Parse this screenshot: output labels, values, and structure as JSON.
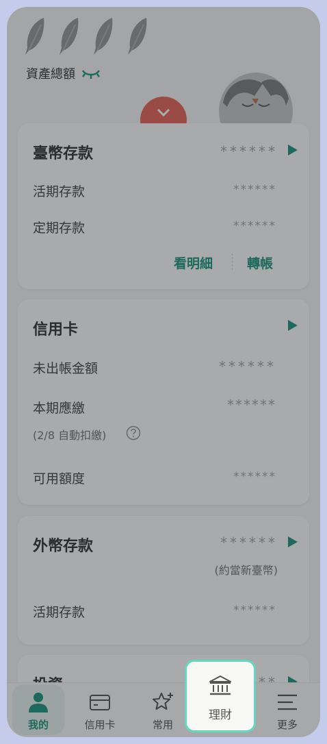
{
  "header": {
    "asset_title": "資產總額"
  },
  "cards": {
    "twd": {
      "title": "臺幣存款",
      "amount": "******",
      "rows": [
        {
          "label": "活期存款",
          "value": "******"
        },
        {
          "label": "定期存款",
          "value": "******"
        }
      ],
      "actions": {
        "details": "看明細",
        "transfer": "轉帳"
      }
    },
    "credit": {
      "title": "信用卡",
      "rows": [
        {
          "label": "未出帳金額",
          "value": "******"
        },
        {
          "label": "本期應繳",
          "value": "******",
          "note": "(2/8 自動扣繳)"
        },
        {
          "label": "可用額度",
          "value": "******"
        }
      ]
    },
    "foreign": {
      "title": "外幣存款",
      "amount": "******",
      "amount_note": "(約當新臺幣)",
      "rows": [
        {
          "label": "活期存款",
          "value": "******"
        }
      ]
    },
    "invest": {
      "title": "投資",
      "amount": "**"
    }
  },
  "tabs": [
    {
      "label": "我的",
      "icon": "person-icon",
      "active": true
    },
    {
      "label": "信用卡",
      "icon": "credit-card-icon"
    },
    {
      "label": "常用",
      "icon": "star-plus-icon"
    },
    {
      "label": "理財",
      "icon": "bank-icon",
      "highlighted": true
    },
    {
      "label": "更多",
      "icon": "menu-icon"
    }
  ],
  "colors": {
    "accent": "#0b8a72",
    "highlight_border": "#66d7bf",
    "expand_button": "#e4574a",
    "overlay": "#373c41"
  }
}
